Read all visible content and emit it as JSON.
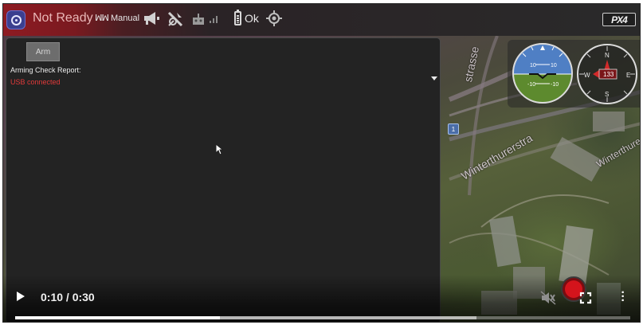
{
  "toolbar": {
    "status": "Not Ready",
    "flight_mode": "Manual",
    "battery_status": "Ok",
    "brand": "PX4",
    "icons": [
      "app-logo",
      "megaphone-icon",
      "gps-off-icon",
      "rc-icon",
      "signal-icon",
      "battery-icon",
      "target-icon"
    ]
  },
  "panel": {
    "arm_button": "Arm",
    "report_label": "Arming Check Report:",
    "report_value": "USB connected",
    "report_value_color": "#e23a3a"
  },
  "map": {
    "streets": [
      "strasse",
      "Winterthurerstra",
      "Winterthurerstrasse",
      "Winterthure"
    ],
    "pin_label": "1"
  },
  "instruments": {
    "attitude": {
      "pitch_labels": [
        "10",
        "10",
        "-10",
        "-10"
      ]
    },
    "compass": {
      "heading": "133",
      "north": "N",
      "east": "E",
      "south": "S",
      "west": "W"
    }
  },
  "video": {
    "current_time": "0:10",
    "duration": "0:30",
    "time_text": "0:10 / 0:30",
    "progress_fraction": 0.333,
    "buffered_fraction": 0.75
  },
  "colors": {
    "toolbar_red": "#8e1b22",
    "record": "#d4141c",
    "sky": "#4f7fc4",
    "ground": "#5d8a2e"
  }
}
